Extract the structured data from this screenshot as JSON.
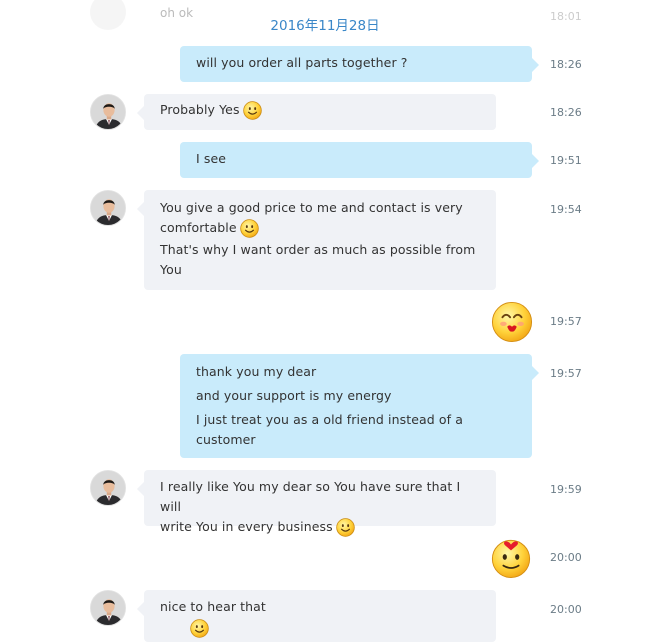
{
  "date_header": "2016年11月28日",
  "ghost_text": "oh ok",
  "ghost_time": "18:01",
  "messages": [
    {
      "type": "out",
      "lines": [
        "will you order all parts together ?"
      ],
      "time": "18:26"
    },
    {
      "type": "in",
      "lines": [
        "Probably Yes"
      ],
      "emoji": "smile",
      "time": "18:26"
    },
    {
      "type": "out",
      "lines": [
        "I see"
      ],
      "time": "19:51"
    },
    {
      "type": "in",
      "lines": [
        "You give a good price to me and contact is very",
        "comfortable",
        "That's why I want order as much as possible from",
        "You"
      ],
      "emoji": "smile",
      "time": "19:54"
    },
    {
      "type": "sticker",
      "emoji": "kiss",
      "time": "19:57"
    },
    {
      "type": "out",
      "lines": [
        "thank you my dear",
        "and your support is my energy",
        "I just treat you as a old friend instead of a",
        "customer"
      ],
      "time": "19:57"
    },
    {
      "type": "in",
      "lines": [
        "I really like You my dear so You have sure that I will",
        "write You in every business"
      ],
      "emoji": "smile",
      "time": "19:59"
    },
    {
      "type": "sticker",
      "emoji": "inlove",
      "time": "20:00"
    },
    {
      "type": "in",
      "lines": [
        "nice to hear that"
      ],
      "time": "20:00"
    }
  ]
}
